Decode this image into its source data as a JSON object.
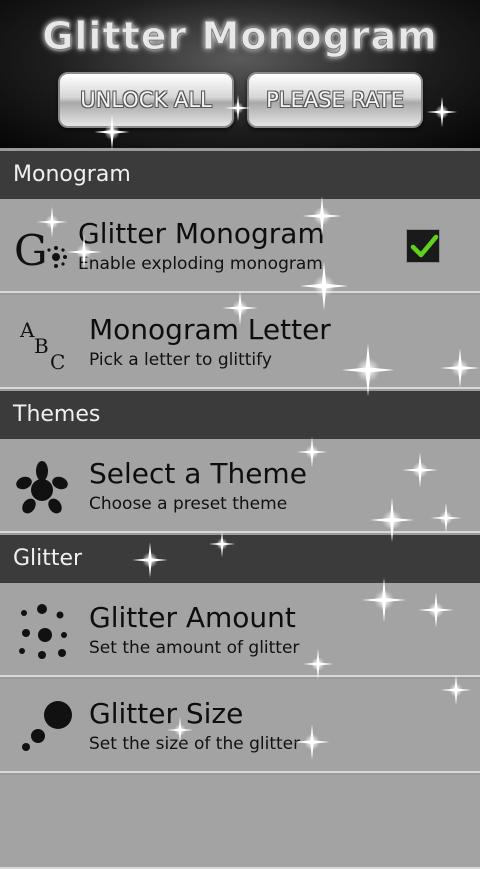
{
  "header": {
    "title": "Glitter Monogram",
    "unlock_label": "UNLOCK ALL",
    "rate_label": "PLEASE RATE"
  },
  "sections": [
    {
      "label": "Monogram",
      "items": [
        {
          "title": "Glitter Monogram",
          "subtitle": "Enable exploding monogram",
          "icon": "glitter-g-icon",
          "checked": true
        },
        {
          "title": "Monogram Letter",
          "subtitle": "Pick a letter to glittify",
          "icon": "abc-letters-icon"
        }
      ]
    },
    {
      "label": "Themes",
      "items": [
        {
          "title": "Select a Theme",
          "subtitle": "Choose a preset theme",
          "icon": "splat-icon"
        }
      ]
    },
    {
      "label": "Glitter",
      "items": [
        {
          "title": "Glitter Amount",
          "subtitle": "Set the amount of glitter",
          "icon": "dots-icon"
        },
        {
          "title": "Glitter Size",
          "subtitle": "Set the size of the glitter",
          "icon": "size-dots-icon"
        }
      ]
    }
  ],
  "icon_text": {
    "g_letter": "G",
    "a_letter": "A",
    "b_letter": "B",
    "c_letter": "C"
  },
  "colors": {
    "section_bg": "#3b3b3b",
    "item_bg": "#a3a3a3",
    "checkbox_mark": "#5fd21e"
  }
}
